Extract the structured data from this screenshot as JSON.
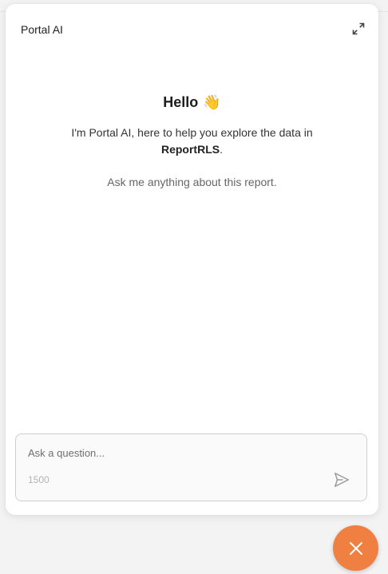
{
  "panel": {
    "title": "Portal AI"
  },
  "welcome": {
    "greeting": "Hello",
    "wave_emoji": "👋",
    "intro_prefix": "I'm Portal AI, here to help you explore the data in",
    "report_name": "ReportRLS",
    "intro_suffix": ".",
    "ask_hint": "Ask me anything about this report."
  },
  "composer": {
    "placeholder": "Ask a question...",
    "char_limit": "1500"
  },
  "icons": {
    "expand": "expand-icon",
    "send": "send-icon",
    "close": "close-icon"
  },
  "colors": {
    "accent": "#f07f42",
    "panel_bg": "#ffffff",
    "page_bg": "#f3f3f3"
  }
}
